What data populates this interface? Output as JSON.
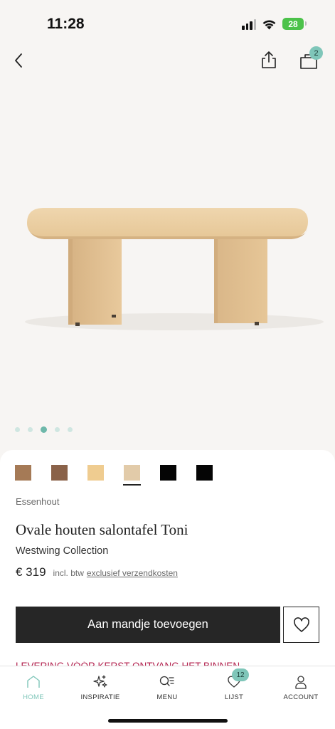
{
  "status_bar": {
    "time": "11:28",
    "battery": "28"
  },
  "nav": {
    "bag_count": "2"
  },
  "gallery": {
    "dots": 5,
    "active_index": 2
  },
  "swatches": [
    {
      "color": "#a57a56",
      "selected": false
    },
    {
      "color": "#8a6249",
      "selected": false
    },
    {
      "color": "#efcc90",
      "selected": false
    },
    {
      "color": "#e2cba9",
      "selected": true
    },
    {
      "color": "#050505",
      "selected": false
    },
    {
      "color": "#050505",
      "selected": false
    }
  ],
  "product": {
    "material": "Essenhout",
    "title": "Ovale houten salontafel Toni",
    "brand": "Westwing Collection",
    "price": "€ 319",
    "vat_note": "incl. btw",
    "shipping_link": "exclusief verzendkosten"
  },
  "actions": {
    "add_to_cart": "Aan mandje toevoegen"
  },
  "promo": {
    "highlight": "LEVERING VÓÓR KERST",
    "rest": " ONTVANG HET BINNEN"
  },
  "tabbar": {
    "items": [
      {
        "label": "HOME",
        "icon": "home-icon",
        "active": true
      },
      {
        "label": "INSPIRATIE",
        "icon": "sparkles-icon",
        "active": false
      },
      {
        "label": "MENU",
        "icon": "menu-search-icon",
        "active": false
      },
      {
        "label": "LIJST",
        "icon": "heart-icon",
        "active": false,
        "badge": "12"
      },
      {
        "label": "ACCOUNT",
        "icon": "user-icon",
        "active": false
      }
    ]
  },
  "colors": {
    "accent": "#7fc6b9",
    "promo": "#b3214e",
    "button": "#262626"
  }
}
